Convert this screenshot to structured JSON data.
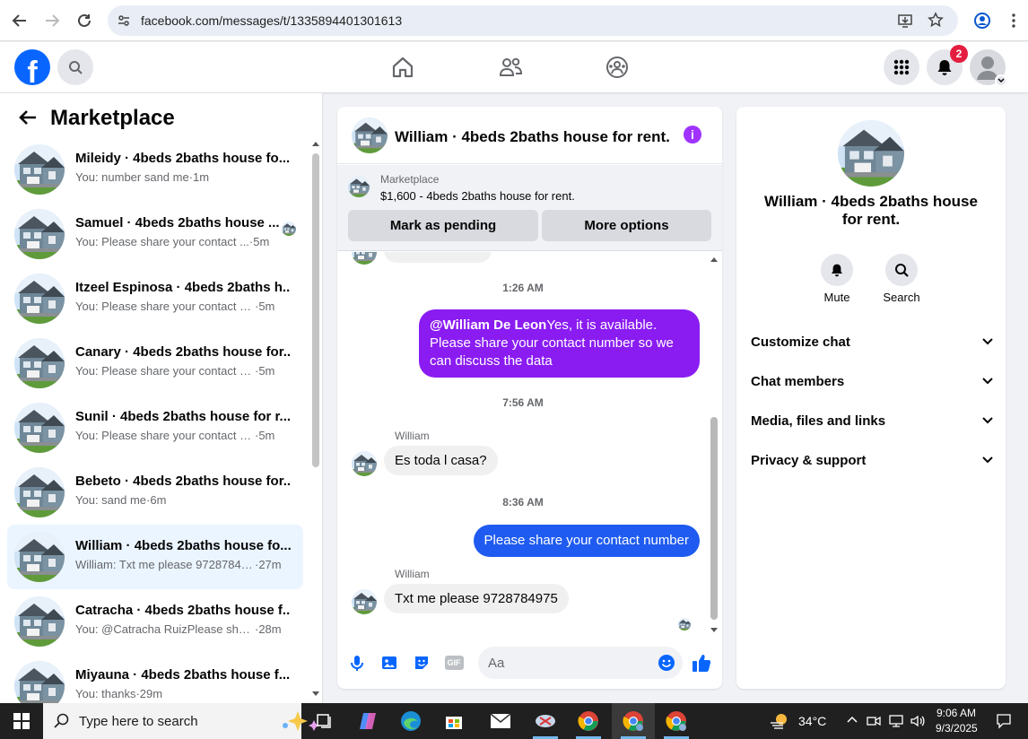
{
  "browser": {
    "url": "facebook.com/messages/t/1335894401301613"
  },
  "header": {
    "logo_letter": "f",
    "notification_count": "2"
  },
  "left": {
    "title": "Marketplace",
    "conversations": [
      {
        "title": "Mileidy · 4beds 2baths house fo...",
        "preview": "You: number sand me",
        "time": "·1m",
        "active": false,
        "seen": false
      },
      {
        "title": "Samuel · 4beds 2baths house ...",
        "preview": "You: Please share your contact ...",
        "time": "·5m",
        "active": false,
        "seen": true
      },
      {
        "title": "Itzeel Espinosa · 4beds 2baths h...",
        "preview": "You: Please share your contact nu...",
        "time": "·5m",
        "active": false,
        "seen": false
      },
      {
        "title": "Canary · 4beds 2baths house for...",
        "preview": "You: Please share your contact nu...",
        "time": "·5m",
        "active": false,
        "seen": false
      },
      {
        "title": "Sunil · 4beds 2baths house for r...",
        "preview": "You: Please share your contact nu...",
        "time": "·5m",
        "active": false,
        "seen": false
      },
      {
        "title": "Bebeto · 4beds 2baths house for...",
        "preview": "You: sand me",
        "time": "·6m",
        "active": false,
        "seen": false
      },
      {
        "title": "William · 4beds 2baths house fo...",
        "preview": "William: Txt me please 9728784975",
        "time": "·27m",
        "active": true,
        "seen": false
      },
      {
        "title": "Catracha · 4beds 2baths house f...",
        "preview": "You: @Catracha RuizPlease share ...",
        "time": "·28m",
        "active": false,
        "seen": false
      },
      {
        "title": "Miyauna · 4beds 2baths house f...",
        "preview": "You: thanks",
        "time": "·29m",
        "active": false,
        "seen": false
      }
    ]
  },
  "chat": {
    "title": "William · 4beds 2baths house for rent.",
    "marketplace_label": "Marketplace",
    "listing": "$1,600 - 4beds 2baths house for rent.",
    "mark_pending": "Mark as pending",
    "more_options": "More options",
    "time1": "1:26 AM",
    "msg1_mention": "@William De Leon",
    "msg1_text": "Yes, it is available. Please share your contact number so we can discuss the data",
    "time2": "7:56 AM",
    "sender1": "William",
    "msg2": "Es toda l casa?",
    "time3": "8:36 AM",
    "msg3": "Please share your contact number",
    "sender2": "William",
    "msg4": "Txt me please 9728784975",
    "input_placeholder": "Aa",
    "gif_label": "GIF"
  },
  "right": {
    "title": "William · 4beds 2baths house for rent.",
    "mute": "Mute",
    "search": "Search",
    "rows": [
      "Customize chat",
      "Chat members",
      "Media, files and links",
      "Privacy & support"
    ]
  },
  "taskbar": {
    "search_placeholder": "Type here to search",
    "temperature": "34°C",
    "time": "9:06 AM",
    "date": "9/3/2025"
  },
  "colors": {
    "fb_blue": "#0866ff",
    "messenger_purple": "#8a1cf2",
    "messenger_blue": "#1f5bf0",
    "active_row": "#ebf5ff"
  }
}
